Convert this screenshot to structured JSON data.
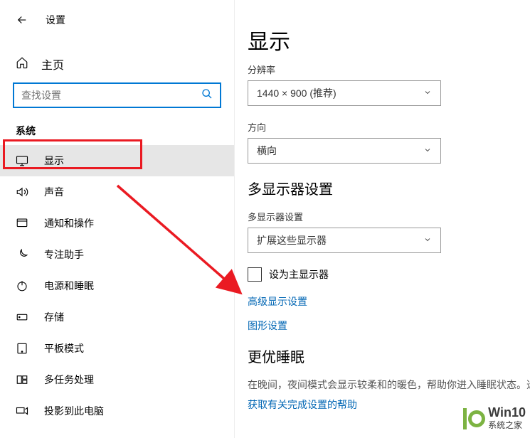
{
  "header": {
    "title": "设置",
    "home_label": "主页"
  },
  "search": {
    "placeholder": "查找设置"
  },
  "section_label": "系统",
  "nav": [
    {
      "label": "显示"
    },
    {
      "label": "声音"
    },
    {
      "label": "通知和操作"
    },
    {
      "label": "专注助手"
    },
    {
      "label": "电源和睡眠"
    },
    {
      "label": "存储"
    },
    {
      "label": "平板模式"
    },
    {
      "label": "多任务处理"
    },
    {
      "label": "投影到此电脑"
    }
  ],
  "main": {
    "title": "显示",
    "resolution_label": "分辨率",
    "resolution_value": "1440 × 900 (推荐)",
    "orientation_label": "方向",
    "orientation_value": "横向",
    "multi_heading": "多显示器设置",
    "multi_label": "多显示器设置",
    "multi_value": "扩展这些显示器",
    "primary_checkbox": "设为主显示器",
    "adv_link": "高级显示设置",
    "gfx_link": "图形设置",
    "sleep_heading": "更优睡眠",
    "sleep_body": "在晚间，夜间模式会显示较柔和的暖色，帮助你进入睡眠状态。选",
    "sleep_link": "获取有关完成设置的帮助"
  },
  "watermark": {
    "line1": "Win10",
    "line2": "系统之家"
  }
}
